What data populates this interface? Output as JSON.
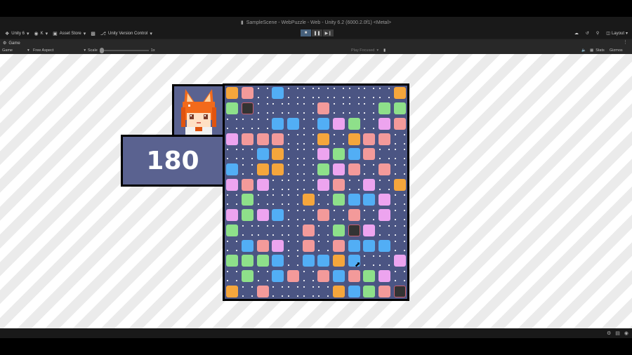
{
  "window": {
    "title": "SampleScene - WebPuzzle - Web - Unity 6.2 (6000.2.0f1) <Metal>"
  },
  "toolbar": {
    "account_label": "Unity 6",
    "user_label": "K",
    "asset_store_label": "Asset Store",
    "version_control_label": "Unity Version Control",
    "layout_label": "Layout"
  },
  "tabs": {
    "game_tab_label": "Game"
  },
  "gamebar": {
    "display_label": "Game",
    "aspect_label": "Free Aspect",
    "scale_label": "Scale",
    "scale_value": "1x",
    "play_focused_label": "Play Focused",
    "stats_label": "Stats",
    "gizmos_label": "Gizmos"
  },
  "game": {
    "score": "180",
    "board": {
      "cols": 12,
      "rows": 14,
      "grid": [
        "O P . B . . . . . . . O",
        "G X . . . . P . . . G G",
        ". . . B B . B L G . L P",
        "L P P P . . O . O P P .",
        ". . B O . . L G B P . .",
        "B . O O . . G L P . P .",
        "L P L . . . L P . L . O",
        ". G . . . O . G B B L . B",
        "L G L B . . P . P . L .",
        "G . . . . P . G X L . .",
        ". B P L . P . P B B B .",
        "G G G B . B B O B . . L",
        ". G . B P . P B P G L .",
        "O . P . . . . O B G P X"
      ]
    },
    "colors": {
      "O": "#f5a63c",
      "P": "#f39a9a",
      "B": "#52aef5",
      "G": "#8ee08a",
      "L": "#eda4ef",
      "X": "#333333",
      "board": "#4b5583",
      "panel": "#5a6290"
    }
  }
}
